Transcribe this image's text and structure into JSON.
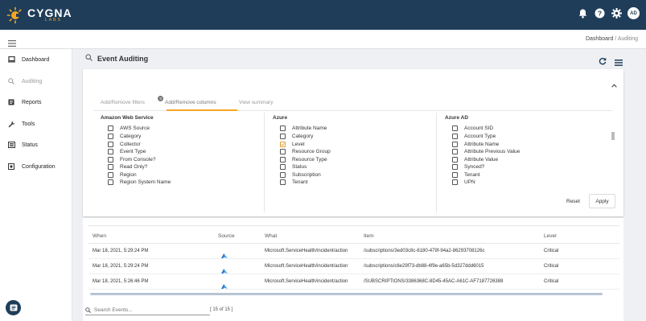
{
  "app": {
    "logo_name": "CYGNA",
    "logo_sub": "LABS",
    "avatar_initials": "AD",
    "brand_color": "#1f3d59",
    "accent_color": "#f5a623"
  },
  "breadcrumb": {
    "home": "Dashboard",
    "separator": "/",
    "current": "Auditing"
  },
  "sidebar": {
    "items": [
      {
        "label": "Dashboard",
        "icon": "laptop-icon"
      },
      {
        "label": "Auditing",
        "icon": "search-icon"
      },
      {
        "label": "Reports",
        "icon": "report-icon"
      },
      {
        "label": "Tools",
        "icon": "wrench-icon"
      },
      {
        "label": "Status",
        "icon": "status-icon"
      },
      {
        "label": "Configuration",
        "icon": "gear-icon"
      }
    ]
  },
  "page": {
    "title": "Event Auditing"
  },
  "filters": {
    "tabs": [
      {
        "label": "Add/Remove filters",
        "badge": "3"
      },
      {
        "label": "Add/Remove columns"
      },
      {
        "label": "View summary"
      }
    ],
    "columns": [
      {
        "title": "Amazon Web Service",
        "options": [
          {
            "label": "AWS Source",
            "checked": false
          },
          {
            "label": "Category",
            "checked": false
          },
          {
            "label": "Collector",
            "checked": false
          },
          {
            "label": "Event Type",
            "checked": false
          },
          {
            "label": "From Console?",
            "checked": false
          },
          {
            "label": "Read Only?",
            "checked": false
          },
          {
            "label": "Region",
            "checked": false
          },
          {
            "label": "Region System Name",
            "checked": false
          }
        ]
      },
      {
        "title": "Azure",
        "options": [
          {
            "label": "Attribute Name",
            "checked": false
          },
          {
            "label": "Category",
            "checked": false
          },
          {
            "label": "Level",
            "checked": true
          },
          {
            "label": "Resource Group",
            "checked": false
          },
          {
            "label": "Resource Type",
            "checked": false
          },
          {
            "label": "Status",
            "checked": false
          },
          {
            "label": "Subscription",
            "checked": false
          },
          {
            "label": "Tenant",
            "checked": false
          }
        ]
      },
      {
        "title": "Azure AD",
        "options": [
          {
            "label": "Account SID",
            "checked": false
          },
          {
            "label": "Account Type",
            "checked": false
          },
          {
            "label": "Attribute Name",
            "checked": false
          },
          {
            "label": "Attribute Previous Value",
            "checked": false
          },
          {
            "label": "Attribute Value",
            "checked": false
          },
          {
            "label": "Synced?",
            "checked": false
          },
          {
            "label": "Tenant",
            "checked": false
          },
          {
            "label": "UPN",
            "checked": false
          }
        ]
      }
    ],
    "reset_label": "Reset",
    "apply_label": "Apply"
  },
  "table": {
    "headers": {
      "when": "When",
      "source": "Source",
      "what": "What",
      "item": "Item",
      "level": "Level"
    },
    "rows": [
      {
        "when": "Mar 18, 2021, 5:29:24 PM",
        "source": "azure-icon",
        "what": "Microsoft.ServiceHealth/incident/action",
        "item": "/subscriptions/3ed03c8c-6180-479f-94a2-86293708126c",
        "level": "Critical"
      },
      {
        "when": "Mar 18, 2021, 5:29:24 PM",
        "source": "azure-icon",
        "what": "Microsoft.ServiceHealth/incident/action",
        "item": "/subscriptions/c6e29f73-db88-4f9e-a65b-5d327ddd6015",
        "level": "Critical"
      },
      {
        "when": "Mar 18, 2021, 5:26:46 PM",
        "source": "azure-icon",
        "what": "Microsoft.ServiceHealth/incident/action",
        "item": "/SUBSCRIPTIONS/3386368C-8D45-45AC-A61C-AF7187726388",
        "level": "Critical"
      }
    ]
  },
  "search": {
    "placeholder": "Search Events...",
    "count": "[ 15 of 15 ]"
  }
}
